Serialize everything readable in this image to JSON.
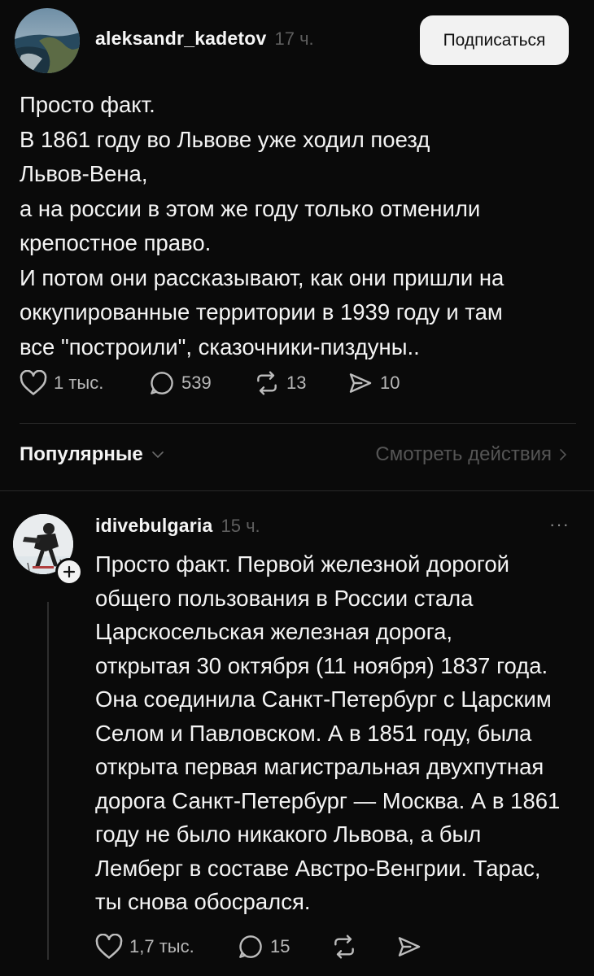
{
  "post": {
    "author": "aleksandr_kadetov",
    "time": "17 ч.",
    "follow_label": "Подписаться",
    "lines": [
      "Просто факт.",
      "В 1861 году во Львове уже ходил поезд",
      "Львов-Вена,",
      "а на россии в этом же году только отменили",
      "крепостное право.",
      "И потом они рассказывают, как они пришли на",
      "оккупированные территории в 1939 году и там",
      "все \"построили\", сказочники-пиздуны.."
    ],
    "likes": "1 тыс.",
    "comments": "539",
    "reposts": "13",
    "shares": "10"
  },
  "filter": {
    "sort_label": "Популярные",
    "view_activity_label": "Смотреть действия"
  },
  "comment": {
    "author": "idivebulgaria",
    "time": "15 ч.",
    "more": "···",
    "lines": [
      "Просто факт. Первой железной дорогой",
      "общего пользования в России стала",
      "Царскосельская железная дорога,",
      "открытая 30 октября (11 ноября) 1837 года.",
      "Она соединила Санкт-Петербург с Царским",
      "Селом и Павловском. А в 1851 году, была",
      "открыта первая магистральная двухпутная",
      "дорога Санкт-Петербург — Москва. А в 1861",
      "году не было никакого Львова, а был",
      "Лемберг в составе Австро-Венгрии. Тарас,",
      "ты снова обосрался."
    ],
    "likes": "1,7 тыс.",
    "comments": "15"
  }
}
